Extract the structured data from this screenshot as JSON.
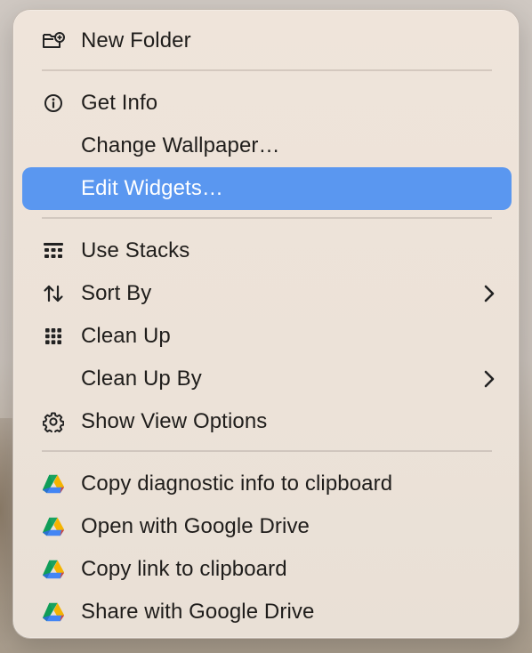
{
  "menu": {
    "items": [
      {
        "label": "New Folder",
        "icon": "new-folder-icon"
      },
      {
        "label": "Get Info",
        "icon": "info-icon"
      },
      {
        "label": "Change Wallpaper…",
        "icon": ""
      },
      {
        "label": "Edit Widgets…",
        "icon": "",
        "highlighted": true
      },
      {
        "label": "Use Stacks",
        "icon": "stacks-icon"
      },
      {
        "label": "Sort By",
        "icon": "sort-icon",
        "submenu": true
      },
      {
        "label": "Clean Up",
        "icon": "grid-icon"
      },
      {
        "label": "Clean Up By",
        "icon": "",
        "submenu": true
      },
      {
        "label": "Show View Options",
        "icon": "gear-icon"
      },
      {
        "label": "Copy diagnostic info to clipboard",
        "icon": "google-drive-icon"
      },
      {
        "label": "Open with Google Drive",
        "icon": "google-drive-icon"
      },
      {
        "label": "Copy link to clipboard",
        "icon": "google-drive-icon"
      },
      {
        "label": "Share with Google Drive",
        "icon": "google-drive-icon"
      }
    ]
  },
  "colors": {
    "highlight": "#5a97f0",
    "text": "#1f1d1b",
    "menu_bg": "#ece2d8"
  }
}
